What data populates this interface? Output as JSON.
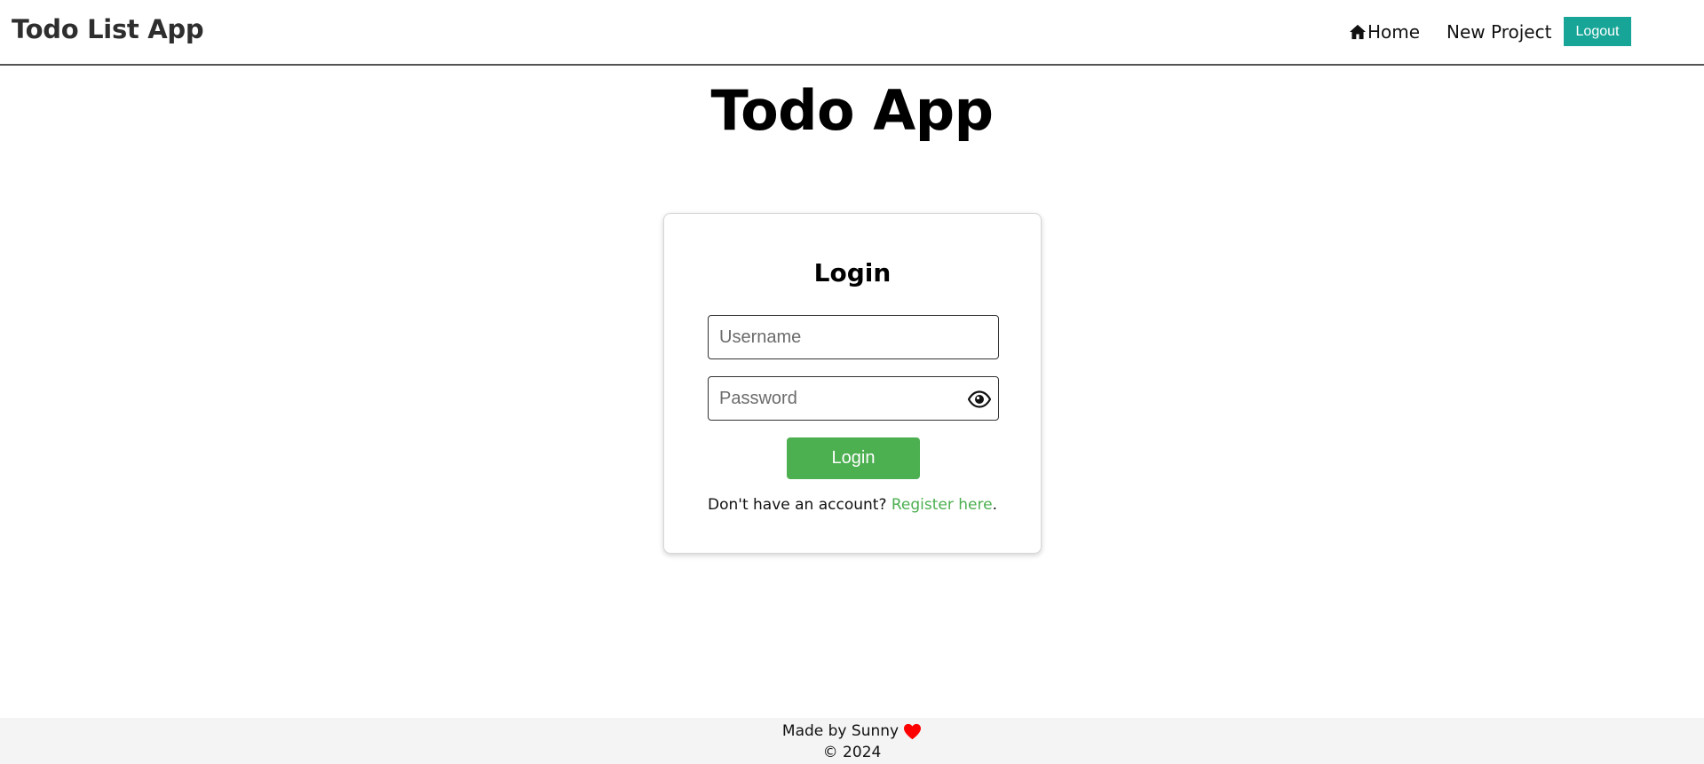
{
  "navbar": {
    "brand": "Todo List App",
    "home_label": "Home",
    "home_icon": "home-icon",
    "new_project_label": "New Project",
    "logout_label": "Logout",
    "logout_color": "#17a597"
  },
  "page": {
    "title": "Todo App"
  },
  "login_form": {
    "title": "Login",
    "username_placeholder": "Username",
    "password_placeholder": "Password",
    "eye_icon": "eye-icon",
    "submit_label": "Login",
    "submit_color": "#4caf50",
    "register_prompt": "Don't have an account? ",
    "register_link": "Register here",
    "register_suffix": "."
  },
  "footer": {
    "made_by": "Made by Sunny",
    "heart_icon": "heart-icon",
    "heart_color": "#ff0000",
    "copyright": "© 2024"
  }
}
